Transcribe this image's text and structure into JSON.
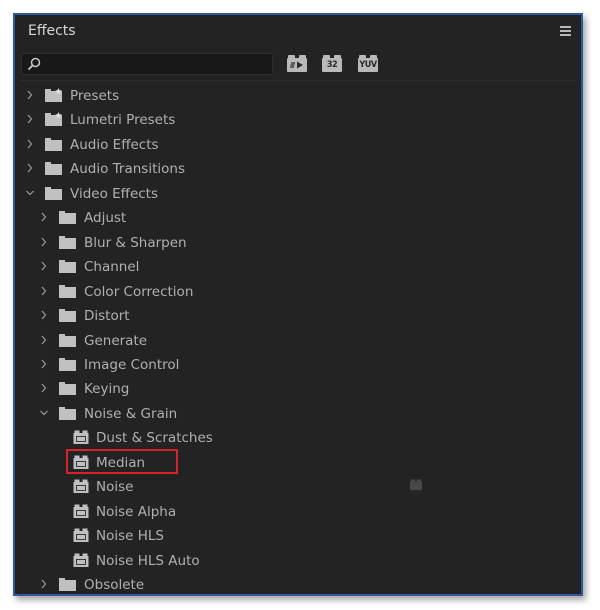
{
  "panel": {
    "title": "Effects",
    "menu_icon": "hamburger-menu-icon"
  },
  "search": {
    "value": "",
    "placeholder": "",
    "icon": "search-icon"
  },
  "filters": [
    {
      "label": "",
      "icon": "accelerated-effects-icon",
      "name": "accelerated-effects-filter"
    },
    {
      "label": "32",
      "icon": "32-bit-color-icon",
      "name": "32bit-color-filter"
    },
    {
      "label": "YUV",
      "icon": "yuv-effects-icon",
      "name": "yuv-effects-filter"
    }
  ],
  "colors": {
    "panel_bg": "#232323",
    "text": "#b0b0b0",
    "highlight": "#d6232c",
    "border_accent": "#2d5a9e"
  },
  "tree": [
    {
      "label": "Presets",
      "level": 0,
      "type": "preset-folder",
      "expanded": false
    },
    {
      "label": "Lumetri Presets",
      "level": 0,
      "type": "preset-folder",
      "expanded": false
    },
    {
      "label": "Audio Effects",
      "level": 0,
      "type": "folder",
      "expanded": false
    },
    {
      "label": "Audio Transitions",
      "level": 0,
      "type": "folder",
      "expanded": false
    },
    {
      "label": "Video Effects",
      "level": 0,
      "type": "folder",
      "expanded": true
    },
    {
      "label": "Adjust",
      "level": 1,
      "type": "folder",
      "expanded": false
    },
    {
      "label": "Blur & Sharpen",
      "level": 1,
      "type": "folder",
      "expanded": false
    },
    {
      "label": "Channel",
      "level": 1,
      "type": "folder",
      "expanded": false
    },
    {
      "label": "Color Correction",
      "level": 1,
      "type": "folder",
      "expanded": false
    },
    {
      "label": "Distort",
      "level": 1,
      "type": "folder",
      "expanded": false
    },
    {
      "label": "Generate",
      "level": 1,
      "type": "folder",
      "expanded": false
    },
    {
      "label": "Image Control",
      "level": 1,
      "type": "folder",
      "expanded": false
    },
    {
      "label": "Keying",
      "level": 1,
      "type": "folder",
      "expanded": false
    },
    {
      "label": "Noise & Grain",
      "level": 1,
      "type": "folder",
      "expanded": true
    },
    {
      "label": "Dust & Scratches",
      "level": 2,
      "type": "effect"
    },
    {
      "label": "Median",
      "level": 2,
      "type": "effect",
      "highlighted": true
    },
    {
      "label": "Noise",
      "level": 2,
      "type": "effect"
    },
    {
      "label": "Noise Alpha",
      "level": 2,
      "type": "effect"
    },
    {
      "label": "Noise HLS",
      "level": 2,
      "type": "effect"
    },
    {
      "label": "Noise HLS Auto",
      "level": 2,
      "type": "effect"
    },
    {
      "label": "Obsolete",
      "level": 1,
      "type": "folder",
      "expanded": false
    }
  ]
}
